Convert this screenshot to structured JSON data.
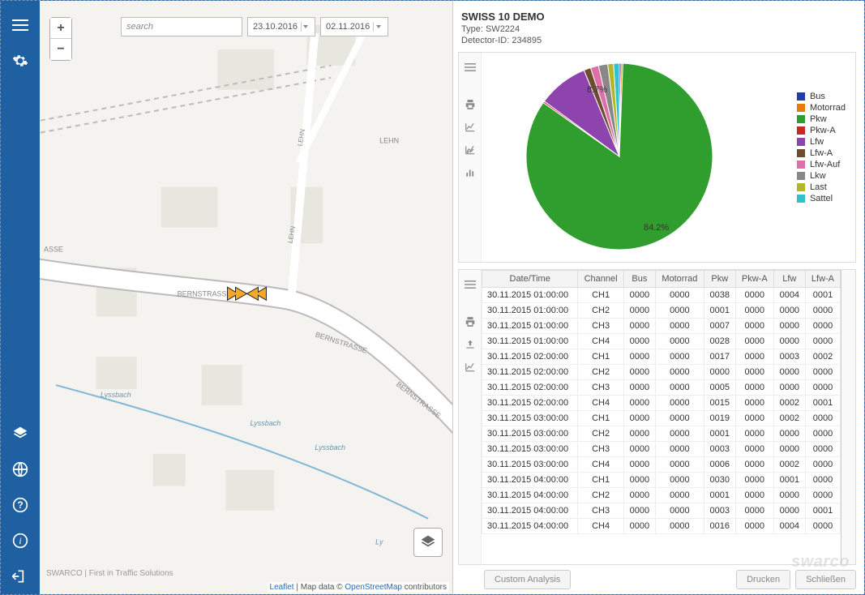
{
  "sidebar": {
    "menu": "menu",
    "settings": "settings",
    "layers": "layers",
    "globe": "globe",
    "help": "help",
    "info": "info",
    "logout": "logout"
  },
  "search": {
    "placeholder": "search"
  },
  "dates": {
    "from": "23.10.2016",
    "to": "02.11.2016"
  },
  "map": {
    "streets": {
      "bern": "BERNSTRASSE",
      "lehn": "LEHN",
      "lyssbach": "Lyssbach",
      "asse": "ASSE",
      "ly": "Ly"
    },
    "attrib": {
      "leaflet": "Leaflet",
      "sep": " | Map data © ",
      "osm": "OpenStreetMap",
      "tail": " contributors"
    },
    "swarco": "SWARCO | First in Traffic Solutions"
  },
  "header": {
    "title": "SWISS 10 DEMO",
    "type_label": "Type:",
    "type_value": "SW2224",
    "det_label": "Detector-ID:",
    "det_value": "234895"
  },
  "chart_data": {
    "type": "pie",
    "title": "",
    "series": [
      {
        "name": "Bus",
        "value": 0.3,
        "color": "#1f3fa8"
      },
      {
        "name": "Motorrad",
        "value": 0.3,
        "color": "#e87b0e"
      },
      {
        "name": "Pkw",
        "value": 84.2,
        "color": "#2f9e2f"
      },
      {
        "name": "Pkw-A",
        "value": 0.3,
        "color": "#c62828"
      },
      {
        "name": "Lfw",
        "value": 8.7,
        "color": "#8e44ad"
      },
      {
        "name": "Lfw-A",
        "value": 1.2,
        "color": "#6d4c2f"
      },
      {
        "name": "Lfw-Auf",
        "value": 1.4,
        "color": "#e06fa9"
      },
      {
        "name": "Lkw",
        "value": 1.6,
        "color": "#888888"
      },
      {
        "name": "Last",
        "value": 1.0,
        "color": "#b5b52a"
      },
      {
        "name": "Sattel",
        "value": 1.0,
        "color": "#33c2c9"
      }
    ],
    "labels_shown": [
      "84.2%",
      "8.7%"
    ]
  },
  "table": {
    "columns": [
      "Date/Time",
      "Channel",
      "Bus",
      "Motorrad",
      "Pkw",
      "Pkw-A",
      "Lfw",
      "Lfw-A"
    ],
    "rows": [
      [
        "30.11.2015 01:00:00",
        "CH1",
        "0000",
        "0000",
        "0038",
        "0000",
        "0004",
        "0001"
      ],
      [
        "30.11.2015 01:00:00",
        "CH2",
        "0000",
        "0000",
        "0001",
        "0000",
        "0000",
        "0000"
      ],
      [
        "30.11.2015 01:00:00",
        "CH3",
        "0000",
        "0000",
        "0007",
        "0000",
        "0000",
        "0000"
      ],
      [
        "30.11.2015 01:00:00",
        "CH4",
        "0000",
        "0000",
        "0028",
        "0000",
        "0000",
        "0000"
      ],
      [
        "30.11.2015 02:00:00",
        "CH1",
        "0000",
        "0000",
        "0017",
        "0000",
        "0003",
        "0002"
      ],
      [
        "30.11.2015 02:00:00",
        "CH2",
        "0000",
        "0000",
        "0000",
        "0000",
        "0000",
        "0000"
      ],
      [
        "30.11.2015 02:00:00",
        "CH3",
        "0000",
        "0000",
        "0005",
        "0000",
        "0000",
        "0000"
      ],
      [
        "30.11.2015 02:00:00",
        "CH4",
        "0000",
        "0000",
        "0015",
        "0000",
        "0002",
        "0001"
      ],
      [
        "30.11.2015 03:00:00",
        "CH1",
        "0000",
        "0000",
        "0019",
        "0000",
        "0002",
        "0000"
      ],
      [
        "30.11.2015 03:00:00",
        "CH2",
        "0000",
        "0000",
        "0001",
        "0000",
        "0000",
        "0000"
      ],
      [
        "30.11.2015 03:00:00",
        "CH3",
        "0000",
        "0000",
        "0003",
        "0000",
        "0000",
        "0000"
      ],
      [
        "30.11.2015 03:00:00",
        "CH4",
        "0000",
        "0000",
        "0006",
        "0000",
        "0002",
        "0000"
      ],
      [
        "30.11.2015 04:00:00",
        "CH1",
        "0000",
        "0000",
        "0030",
        "0000",
        "0001",
        "0000"
      ],
      [
        "30.11.2015 04:00:00",
        "CH2",
        "0000",
        "0000",
        "0001",
        "0000",
        "0000",
        "0000"
      ],
      [
        "30.11.2015 04:00:00",
        "CH3",
        "0000",
        "0000",
        "0003",
        "0000",
        "0000",
        "0001"
      ],
      [
        "30.11.2015 04:00:00",
        "CH4",
        "0000",
        "0000",
        "0016",
        "0000",
        "0004",
        "0000"
      ]
    ]
  },
  "footer": {
    "custom": "Custom Analysis",
    "print": "Drucken",
    "close": "Schließen"
  },
  "logo": "swarco"
}
